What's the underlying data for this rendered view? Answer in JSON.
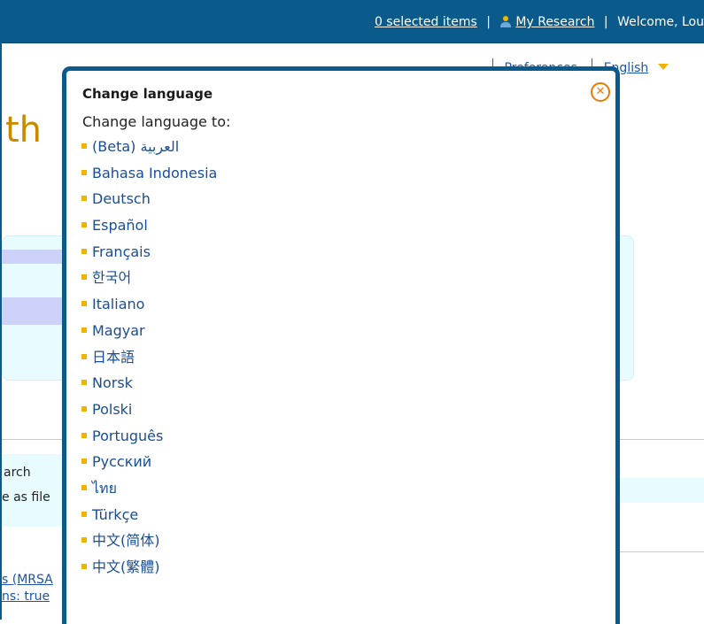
{
  "topbar": {
    "selected_items": "0 selected items",
    "my_research": "My Research",
    "welcome": "Welcome, Lou",
    "divider": "|",
    "user_icon": "user-icon"
  },
  "page": {
    "pref_link": "Preferences",
    "language_link": "English",
    "heading_fragment": "th",
    "search_text": "arch",
    "save_text": "e as file",
    "link1": "s (MRSA",
    "link2": "ns: true"
  },
  "modal": {
    "title": "Change language",
    "close_icon": "close-circle-icon",
    "subtitle": "Change language to:",
    "languages": [
      "العربية (Beta)",
      "Bahasa Indonesia",
      "Deutsch",
      "Español",
      "Français",
      "한국어",
      "Italiano",
      "Magyar",
      "日本語",
      "Norsk",
      "Polski",
      "Português",
      "Русский",
      "ไทย",
      "Türkçe",
      "中文(简体)",
      "中文(繁體)"
    ]
  },
  "colors": {
    "accent_blue": "#0a5a8c",
    "link_blue": "#1a4d94",
    "bullet_yellow": "#f0b400",
    "close_orange": "#f07a00"
  }
}
